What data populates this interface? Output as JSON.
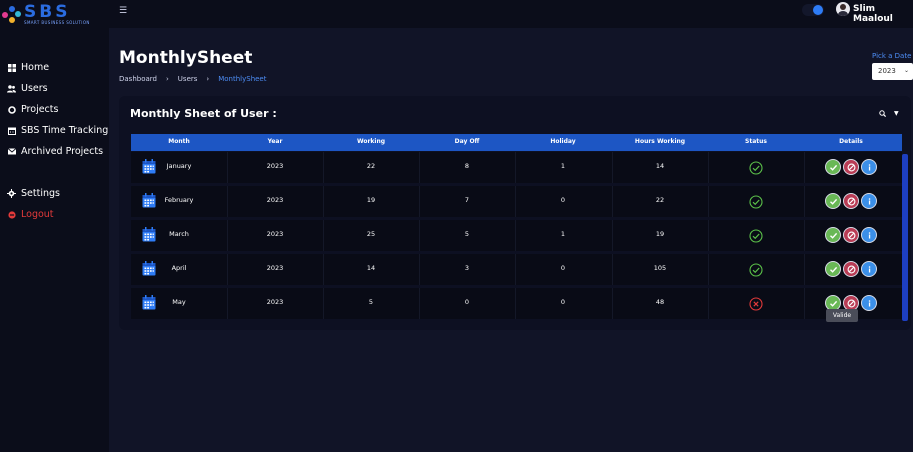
{
  "app": {
    "logo_text": "SBS",
    "logo_subtitle": "SMART BUSINESS SOLUTION",
    "menu_icon": "hamburger-icon",
    "user_name": "Slim Maaloul",
    "accent_color": "#1d56c4"
  },
  "sidebar": {
    "items": [
      {
        "label": "Home",
        "icon": "grid-icon"
      },
      {
        "label": "Users",
        "icon": "users-icon"
      },
      {
        "label": "Projects",
        "icon": "circle-icon"
      },
      {
        "label": "SBS Time Tracking",
        "icon": "calendar-icon"
      },
      {
        "label": "Archived Projects",
        "icon": "mail-icon"
      },
      {
        "label": "Settings",
        "icon": "gear-icon"
      },
      {
        "label": "Logout",
        "icon": "logout-icon"
      }
    ]
  },
  "header": {
    "title": "MonthlySheet",
    "breadcrumb": [
      "Dashboard",
      "Users",
      "MonthlySheet"
    ],
    "pick_date_label": "Pick a Date",
    "year_selected": "2023"
  },
  "card": {
    "title": "Monthly Sheet of User :",
    "columns": [
      "Month",
      "Year",
      "Working",
      "Day Off",
      "Holiday",
      "Hours Working",
      "Status",
      "Details"
    ],
    "rows": [
      {
        "month": "January",
        "year": "2023",
        "working": "22",
        "day_off": "8",
        "holiday": "1",
        "hours": "14",
        "status": "valid"
      },
      {
        "month": "February",
        "year": "2023",
        "working": "19",
        "day_off": "7",
        "holiday": "0",
        "hours": "22",
        "status": "valid"
      },
      {
        "month": "March",
        "year": "2023",
        "working": "25",
        "day_off": "5",
        "holiday": "1",
        "hours": "19",
        "status": "valid"
      },
      {
        "month": "April",
        "year": "2023",
        "working": "14",
        "day_off": "3",
        "holiday": "0",
        "hours": "105",
        "status": "valid"
      },
      {
        "month": "May",
        "year": "2023",
        "working": "5",
        "day_off": "0",
        "holiday": "0",
        "hours": "48",
        "status": "invalid"
      }
    ],
    "tooltip": "Valide",
    "status_colors": {
      "valid": "#5cc24a",
      "invalid": "#e23a3a"
    }
  }
}
